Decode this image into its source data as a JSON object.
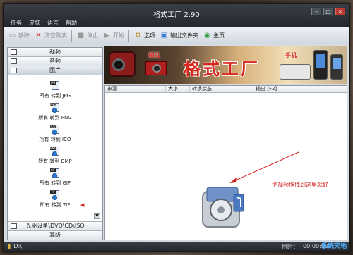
{
  "window": {
    "title": "格式工厂 2.90"
  },
  "menu": [
    "任务",
    "皮肤",
    "语言",
    "帮助"
  ],
  "toolbar": {
    "buttons": [
      {
        "label": "移除",
        "icon": "remove-icon",
        "enabled": false
      },
      {
        "label": "清空列表",
        "icon": "clear-list-icon",
        "enabled": false
      },
      {
        "label": "停止",
        "icon": "stop-icon",
        "enabled": false
      },
      {
        "label": "开始",
        "icon": "start-icon",
        "enabled": false
      },
      {
        "label": "选项",
        "icon": "options-icon",
        "enabled": true
      },
      {
        "label": "输出文件夹",
        "icon": "output-folder-icon",
        "enabled": true
      },
      {
        "label": "主页",
        "icon": "home-icon",
        "enabled": true
      }
    ]
  },
  "sidebar": {
    "categories": [
      "视频",
      "音频",
      "图片"
    ],
    "items": [
      {
        "label": "所有 转到 JPG",
        "badge": "JPG"
      },
      {
        "label": "所有 转到 PNG",
        "badge": "PNG"
      },
      {
        "label": "所有 转到 ICO",
        "badge": "ICO"
      },
      {
        "label": "所有 转到 BMP",
        "badge": "BMP"
      },
      {
        "label": "所有 转到 GIF",
        "badge": "GIF"
      },
      {
        "label": "所有 转到 TIF",
        "badge": "TIF"
      }
    ],
    "bottom_categories": [
      "光驱设备\\DVD\\CD\\ISO",
      "高级"
    ]
  },
  "banner": {
    "title": "格式工厂",
    "tag_camera": "相机",
    "tag_phone": "手机"
  },
  "table": {
    "columns": [
      "来源",
      "大小",
      "转换状态",
      "输出 [F2]"
    ],
    "hint": "把视频拖拽到这里就好"
  },
  "status": {
    "drive": "D:\\",
    "elapsed_label": "用时：",
    "elapsed_value": "00:00:00",
    "watermark": "系统天地"
  },
  "colors": {
    "accent_red": "#d0201c",
    "titlebar": "#23272d"
  }
}
